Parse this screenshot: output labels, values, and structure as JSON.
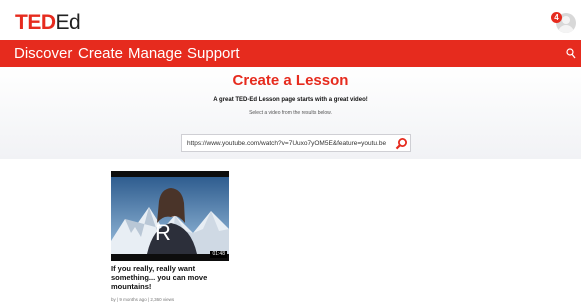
{
  "header": {
    "logo_ted": "TED",
    "logo_ed": "Ed",
    "notification_count": "4"
  },
  "nav": {
    "items": [
      {
        "label": "Discover"
      },
      {
        "label": "Create"
      },
      {
        "label": "Manage"
      },
      {
        "label": "Support"
      }
    ],
    "search_icon": "search-icon"
  },
  "page": {
    "title": "Create a Lesson",
    "subtitle": "A great TED-Ed Lesson page starts with a great video!",
    "instruction": "Select a video from the results below.",
    "url_value": "https://www.youtube.com/watch?v=7Uuxo7yOM5E&feature=youtu.be"
  },
  "video": {
    "duration": "01:48",
    "overlay_letter": "R",
    "title": "If you really, really want something... you can move mountains!",
    "meta": "by | 9 months ago | 2,360 views"
  },
  "colors": {
    "brand_red": "#e62b1e"
  }
}
